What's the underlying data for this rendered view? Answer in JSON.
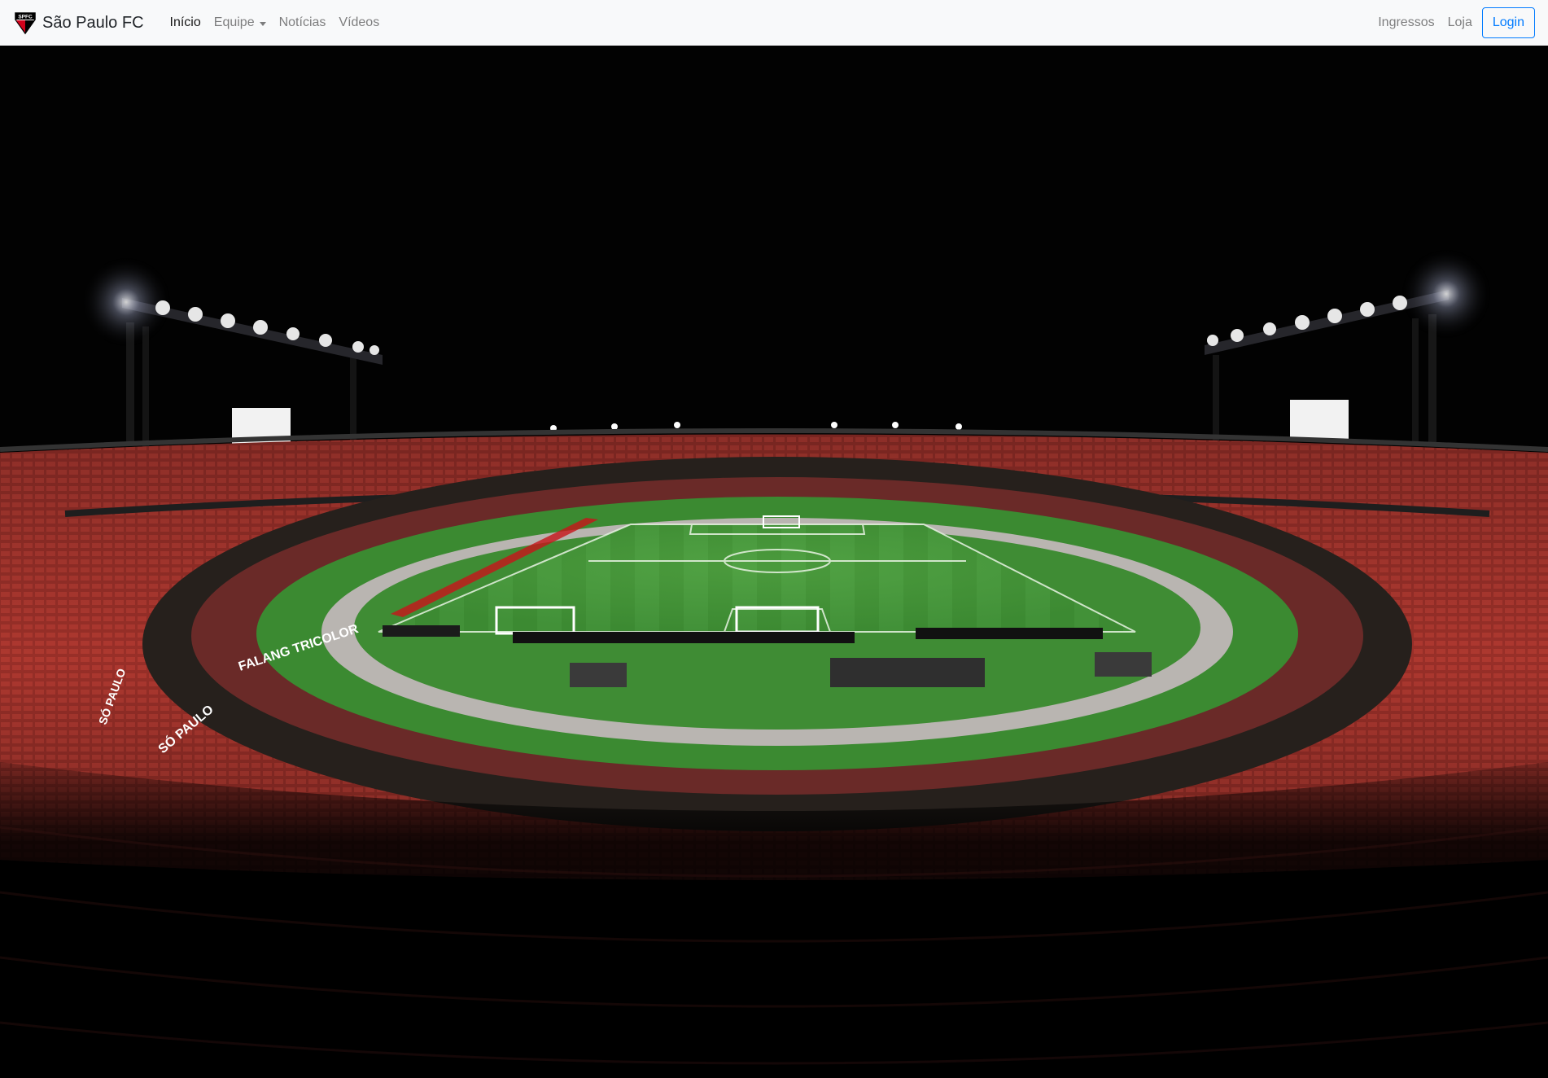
{
  "navbar": {
    "brand": {
      "name": "São Paulo FC",
      "logo_icon": "spfc-crest-icon",
      "logo_text": "SPFC"
    },
    "links_left": [
      {
        "label": "Início",
        "active": true
      },
      {
        "label": "Equipe",
        "dropdown": true
      },
      {
        "label": "Notícias"
      },
      {
        "label": "Vídeos"
      }
    ],
    "links_right": [
      {
        "label": "Ingressos"
      },
      {
        "label": "Loja"
      }
    ],
    "login_label": "Login"
  },
  "hero": {
    "image_subject": "night-stadium-photo",
    "colors": {
      "sky": "#000000",
      "stands": "#8a2a25",
      "pitch": "#3f8f35",
      "floodlight": "#ffffff"
    },
    "banners": [
      "FALANG TRICOLOR",
      "SÓ PAULO",
      "SÓ PAULO"
    ]
  },
  "theme": {
    "accent": "#007bff",
    "navbar_bg": "#f8f9fa"
  }
}
